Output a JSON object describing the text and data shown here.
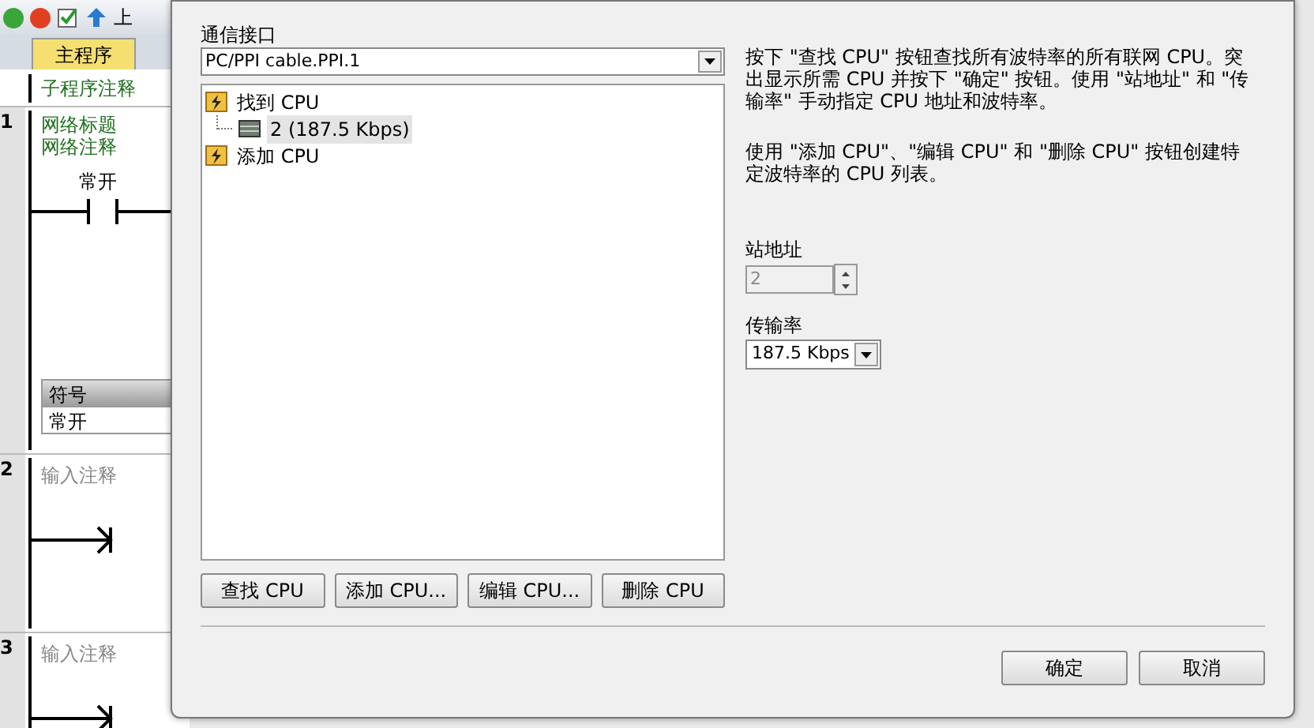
{
  "background": {
    "toolbar": {
      "upload_label": "上"
    },
    "tabs": [
      {
        "label": "主程序",
        "selected": true
      }
    ],
    "subroutine_comment": "子程序注释",
    "networks": [
      {
        "number": "1",
        "title": "网络标题",
        "comment": "网络注释",
        "contact": "常开",
        "symbol_header": "符号",
        "symbol_value": "常开",
        "kind": "contact"
      },
      {
        "number": "2",
        "comment": "输入注释",
        "kind": "empty"
      },
      {
        "number": "3",
        "comment": "输入注释",
        "kind": "empty"
      }
    ]
  },
  "dialog": {
    "interface_label": "通信接口",
    "interface_value": "PC/PPI cable.PPI.1",
    "tree": [
      {
        "label": "找到 CPU",
        "kind": "folder",
        "children": [
          {
            "label": "2 (187.5 Kbps)",
            "kind": "cpu",
            "selected": true
          }
        ]
      },
      {
        "label": "添加 CPU",
        "kind": "folder"
      }
    ],
    "help": [
      "按下 \"查找 CPU\" 按钮查找所有波特率的所有联网 CPU。突出显示所需 CPU 并按下 \"确定\" 按钮。使用 \"站地址\" 和 \"传输率\" 手动指定 CPU 地址和波特率。",
      "使用 \"添加 CPU\"、\"编辑 CPU\" 和 \"删除 CPU\" 按钮创建特定波特率的 CPU 列表。"
    ],
    "address_label": "站地址",
    "address_value": "2",
    "address_disabled": true,
    "rate_label": "传输率",
    "rate_value": "187.5 Kbps",
    "list_buttons": [
      "查找 CPU",
      "添加 CPU...",
      "编辑 CPU...",
      "删除 CPU"
    ],
    "buttons": [
      "确定",
      "取消"
    ]
  }
}
